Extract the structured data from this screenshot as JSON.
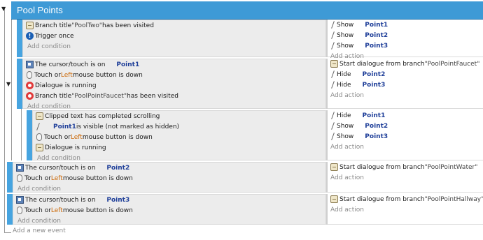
{
  "group": {
    "title": "Pool Points",
    "toggle": "▼"
  },
  "add_event": "Add a new event",
  "add_condition": "Add condition",
  "add_action": "Add action",
  "events": [
    {
      "conditions": [
        {
          "icon": "dialogue-icon",
          "parts": [
            [
              "",
              "Branch title "
            ],
            [
              "str",
              "\"PoolTwo\""
            ],
            [
              "",
              " has been visited"
            ]
          ]
        },
        {
          "icon": "info-icon",
          "parts": [
            [
              "",
              "Trigger once"
            ]
          ]
        }
      ],
      "actions": [
        {
          "parts": [
            [
              "",
              "Show"
            ],
            [
              "gap",
              ""
            ],
            [
              "obj",
              "Point1"
            ]
          ]
        },
        {
          "parts": [
            [
              "",
              "Show"
            ],
            [
              "gap",
              ""
            ],
            [
              "obj",
              "Point2"
            ]
          ]
        },
        {
          "parts": [
            [
              "",
              "Show"
            ],
            [
              "gap",
              ""
            ],
            [
              "obj",
              "Point3"
            ]
          ]
        }
      ]
    },
    {
      "conditions": [
        {
          "icon": "touch-icon",
          "parts": [
            [
              "",
              "The cursor/touch is on"
            ],
            [
              "gap",
              ""
            ],
            [
              "obj",
              "Point1"
            ]
          ]
        },
        {
          "icon": "mouse-icon",
          "parts": [
            [
              "",
              "Touch or "
            ],
            [
              "kw",
              "Left"
            ],
            [
              "",
              " mouse button is down"
            ]
          ]
        },
        {
          "icon": "invert-icon",
          "parts": [
            [
              "",
              "Dialogue is running"
            ]
          ]
        },
        {
          "icon": "invert-icon",
          "parts": [
            [
              "",
              "Branch title "
            ],
            [
              "str",
              "\"PoolPointFaucet\""
            ],
            [
              "",
              " has been visited"
            ]
          ]
        }
      ],
      "actions": [
        {
          "parts": [
            [
              "",
              "Start dialogue from branch "
            ],
            [
              "str",
              "\"PoolPointFaucet\""
            ]
          ]
        },
        {
          "parts": [
            [
              "",
              "Hide"
            ],
            [
              "gap",
              ""
            ],
            [
              "obj",
              "Point2"
            ]
          ]
        },
        {
          "parts": [
            [
              "",
              "Hide"
            ],
            [
              "gap",
              ""
            ],
            [
              "obj",
              "Point3"
            ]
          ]
        }
      ]
    },
    {
      "conditions": [
        {
          "icon": "dialogue-icon",
          "parts": [
            [
              "",
              "Clipped text has completed scrolling"
            ]
          ]
        },
        {
          "icon": "visible-icon",
          "parts": [
            [
              "gap",
              ""
            ],
            [
              "obj",
              "Point1"
            ],
            [
              "",
              " is visible (not marked as hidden)"
            ]
          ]
        },
        {
          "icon": "mouse-icon",
          "parts": [
            [
              "",
              "Touch or "
            ],
            [
              "kw",
              "Left"
            ],
            [
              "",
              " mouse button is down"
            ]
          ]
        },
        {
          "icon": "dialogue-icon",
          "parts": [
            [
              "",
              "Dialogue is running"
            ]
          ]
        }
      ],
      "actions": [
        {
          "parts": [
            [
              "",
              "Hide"
            ],
            [
              "gap",
              ""
            ],
            [
              "obj",
              "Point1"
            ]
          ]
        },
        {
          "parts": [
            [
              "",
              "Show"
            ],
            [
              "gap",
              ""
            ],
            [
              "obj",
              "Point2"
            ]
          ]
        },
        {
          "parts": [
            [
              "",
              "Show"
            ],
            [
              "gap",
              ""
            ],
            [
              "obj",
              "Point3"
            ]
          ]
        }
      ]
    },
    {
      "conditions": [
        {
          "icon": "touch-icon",
          "parts": [
            [
              "",
              "The cursor/touch is on"
            ],
            [
              "gap",
              ""
            ],
            [
              "obj",
              "Point2"
            ]
          ]
        },
        {
          "icon": "mouse-icon",
          "parts": [
            [
              "",
              "Touch or "
            ],
            [
              "kw",
              "Left"
            ],
            [
              "",
              " mouse button is down"
            ]
          ]
        }
      ],
      "actions": [
        {
          "parts": [
            [
              "",
              "Start dialogue from branch "
            ],
            [
              "str",
              "\"PoolPointWater\""
            ]
          ]
        }
      ]
    },
    {
      "conditions": [
        {
          "icon": "touch-icon",
          "parts": [
            [
              "",
              "The cursor/touch is on"
            ],
            [
              "gap",
              ""
            ],
            [
              "obj",
              "Point3"
            ]
          ]
        },
        {
          "icon": "mouse-icon",
          "parts": [
            [
              "",
              "Touch or "
            ],
            [
              "kw",
              "Left"
            ],
            [
              "",
              " mouse button is down"
            ]
          ]
        }
      ],
      "actions": [
        {
          "parts": [
            [
              "",
              "Start dialogue from branch "
            ],
            [
              "str",
              "\"PoolPointHallway\""
            ]
          ]
        }
      ]
    }
  ]
}
